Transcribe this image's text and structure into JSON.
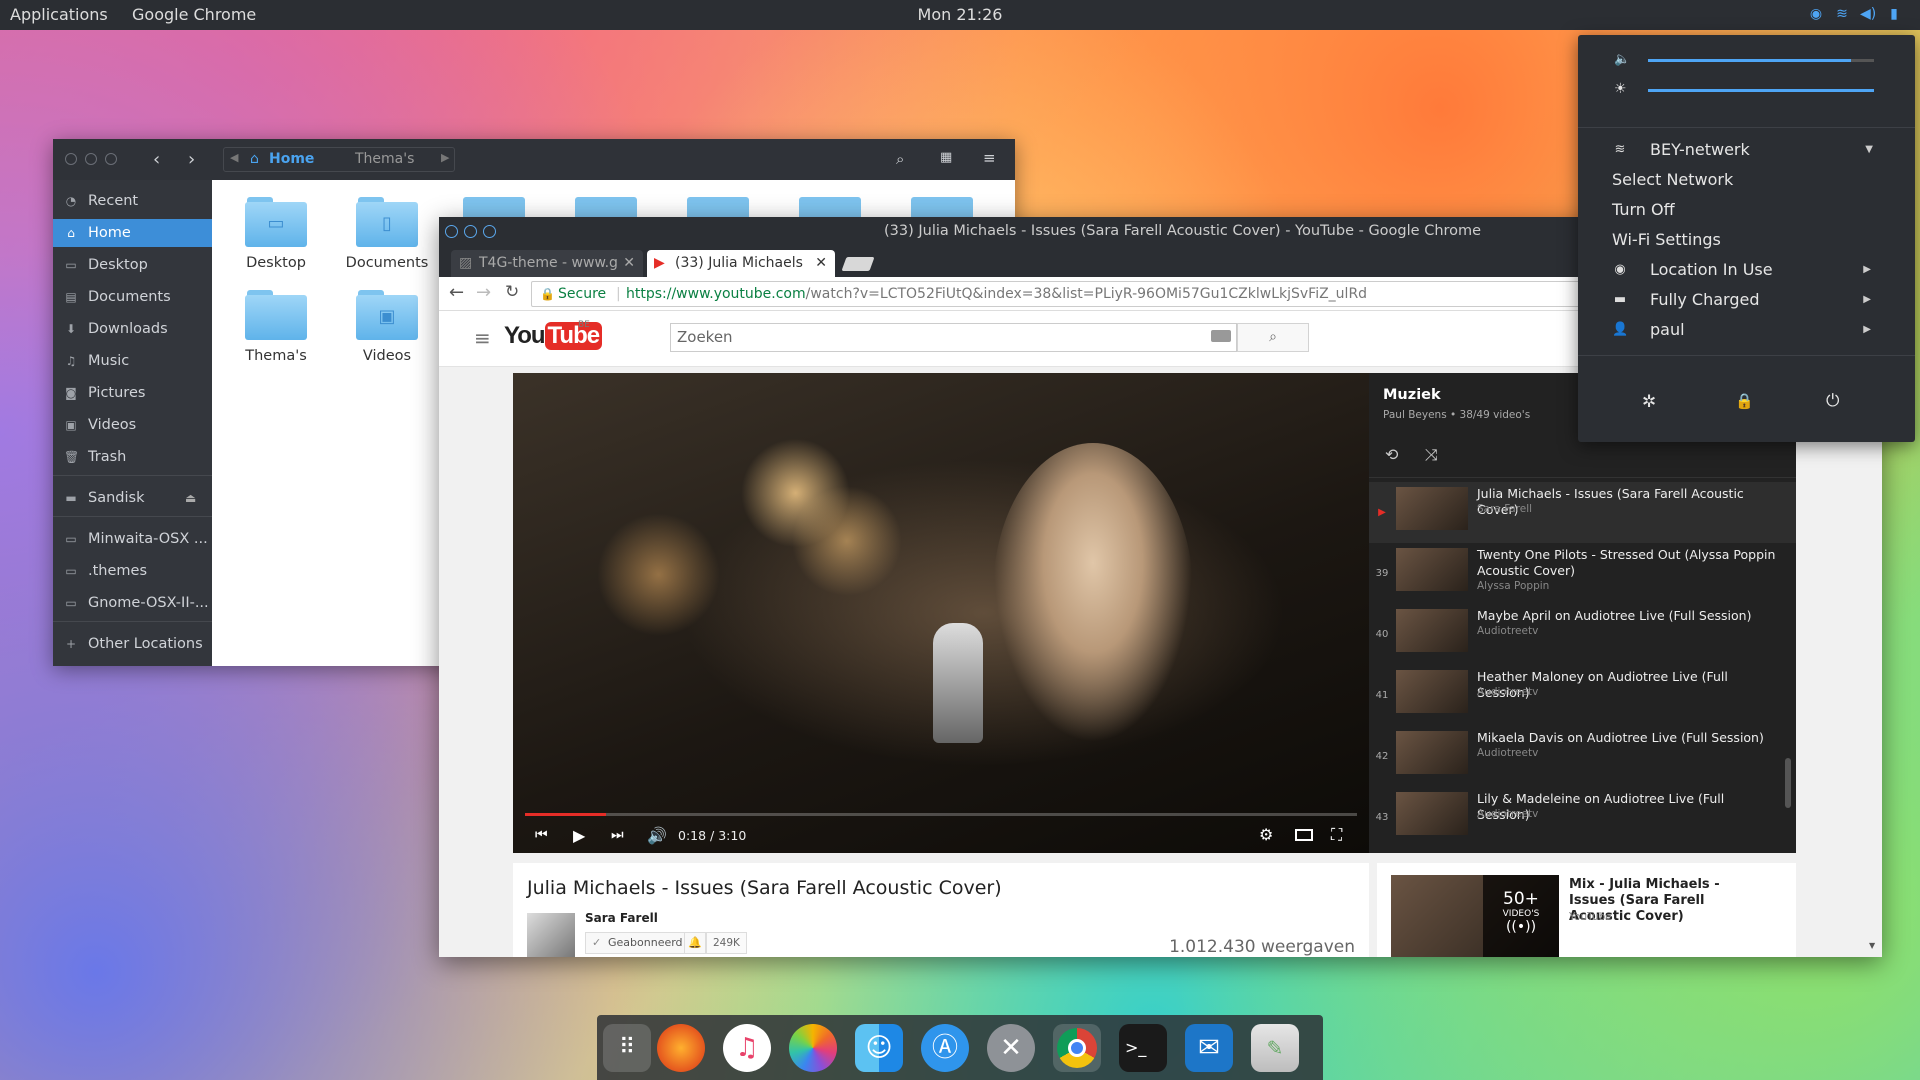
{
  "topbar": {
    "applications": "Applications",
    "app_name": "Google Chrome",
    "clock": "Mon 21:26"
  },
  "files": {
    "breadcrumb": [
      "Home",
      "Thema's"
    ],
    "sidebar": [
      {
        "label": "Recent",
        "icon": "clock-icon"
      },
      {
        "label": "Home",
        "icon": "home-icon"
      },
      {
        "label": "Desktop",
        "icon": "desktop-icon"
      },
      {
        "label": "Documents",
        "icon": "document-icon"
      },
      {
        "label": "Downloads",
        "icon": "download-icon"
      },
      {
        "label": "Music",
        "icon": "music-icon"
      },
      {
        "label": "Pictures",
        "icon": "camera-icon"
      },
      {
        "label": "Videos",
        "icon": "video-icon"
      },
      {
        "label": "Trash",
        "icon": "trash-icon"
      },
      {
        "label": "Sandisk",
        "icon": "drive-icon"
      },
      {
        "label": "Minwaita-OSX ...",
        "icon": "folder-icon"
      },
      {
        "label": ".themes",
        "icon": "folder-icon"
      },
      {
        "label": "Gnome-OSX-II-...",
        "icon": "folder-icon"
      },
      {
        "label": "Other Locations",
        "icon": "plus-icon"
      }
    ],
    "folders": [
      "Desktop",
      "Documents",
      "Thema's",
      "Videos"
    ]
  },
  "chrome": {
    "title": "(33) Julia Michaels - Issues (Sara Farell Acoustic Cover) - YouTube - Google Chrome",
    "tabs": [
      "T4G-theme - www.g",
      "(33) Julia Michaels"
    ],
    "secure": "Secure",
    "url_host": "https://www.youtube.com",
    "url_path": "/watch?v=LCTO52FiUtQ&index=38&list=PLiyR-96OMi57Gu1CZklwLkjSvFiZ_ulRd"
  },
  "youtube": {
    "logo_you": "You",
    "logo_tube": "Tube",
    "region": "BE",
    "search_placeholder": "Zoeken",
    "time": "0:18 / 3:10",
    "progress": 0.097,
    "video_title": "Julia Michaels - Issues (Sara Farell Acoustic Cover)",
    "channel": "Sara Farell",
    "subscribed": "Geabonneerd",
    "subs": "249K",
    "views": "1.012.430 weergaven",
    "playlist": {
      "title": "Muziek",
      "meta": "Paul Beyens • 38/49 video's",
      "items": [
        {
          "num": "▶",
          "title": "Julia Michaels - Issues (Sara Farell Acoustic Cover)",
          "channel": "Sara Farell"
        },
        {
          "num": "39",
          "title": "Twenty One Pilots - Stressed Out (Alyssa Poppin Acoustic Cover)",
          "channel": "Alyssa Poppin"
        },
        {
          "num": "40",
          "title": "Maybe April on Audiotree Live (Full Session)",
          "channel": "Audiotreetv"
        },
        {
          "num": "41",
          "title": "Heather Maloney on Audiotree Live (Full Session)",
          "channel": "Audiotreetv"
        },
        {
          "num": "42",
          "title": "Mikaela Davis on Audiotree Live (Full Session)",
          "channel": "Audiotreetv"
        },
        {
          "num": "43",
          "title": "Lily & Madeleine on Audiotree Live (Full Session)",
          "channel": "Audiotreetv"
        }
      ]
    },
    "mix": {
      "title": "Mix - Julia Michaels - Issues (Sara Farell Acoustic Cover)",
      "channel": "YouTube",
      "count": "50+",
      "count_label": "VIDEO'S"
    }
  },
  "quick_settings": {
    "volume": 0.9,
    "brightness": 1.0,
    "wifi": "BEY-netwerk",
    "select_network": "Select Network",
    "turn_off": "Turn Off",
    "wifi_settings": "Wi-Fi Settings",
    "location": "Location In Use",
    "battery": "Fully Charged",
    "user": "paul"
  },
  "dock": [
    "apps-grid-icon",
    "firefox-icon",
    "music-icon",
    "photos-icon",
    "finder-icon",
    "app-store-icon",
    "settings-icon",
    "chrome-icon",
    "terminal-icon",
    "mail-icon",
    "notes-icon"
  ]
}
